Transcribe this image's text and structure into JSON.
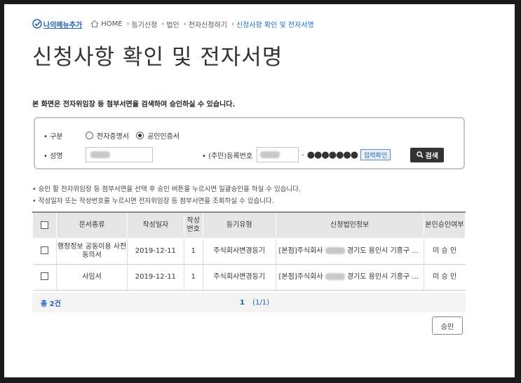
{
  "breadcrumb": {
    "my_menu": "나의메뉴추가",
    "items": [
      "HOME",
      "등기신청",
      "법인",
      "전자신청하기"
    ],
    "current": "신청사항 확인 및 전자서명"
  },
  "page_title": "신청사항 확인 및 전자서명",
  "intro": "본 화면은 전자위임장 등 첨부서면을 검색하여 승인하실 수 있습니다.",
  "search": {
    "type_label": "구분",
    "options": [
      "전자증명서",
      "공인인증서"
    ],
    "selected": "공인인증서",
    "name_label": "성명",
    "reg_label": "(주민)등록번호",
    "reg_masked": "●●●●●●●",
    "confirm_label": "입력확인",
    "search_label": "검색"
  },
  "notes": [
    "승인 할 전자위임장 등 첨부서면을 선택 후 승인 버튼을 누르시면 일괄승인을 하실 수 있습니다.",
    "작성일자 또는 작성번호를 누르시면 전자위임장 등 첨부서면을 조회하실 수 있습니다."
  ],
  "table": {
    "headers": [
      "문서종류",
      "작성일자",
      "작성번호",
      "등기유형",
      "신청법인정보",
      "본인승인여부"
    ],
    "rows": [
      {
        "doc_type": "행정정보 공동이용 사전동의서",
        "date": "2019-12-11",
        "no": "1",
        "reg_type": "주식회사변경등기",
        "corp_prefix": "[본점]주식회사",
        "corp_suffix": "경기도 용인시 기흥구 ...",
        "status": "미 승 인"
      },
      {
        "doc_type": "사임서",
        "date": "2019-12-11",
        "no": "1",
        "reg_type": "주식회사변경등기",
        "corp_prefix": "[본점]주식회사",
        "corp_suffix": "경기도 용인시 기흥구 ...",
        "status": "미 승 인"
      }
    ]
  },
  "footer": {
    "total": "총 2건",
    "current_page": "1",
    "page_info": "(1/1)"
  },
  "approve_label": "승인",
  "colors": {
    "accent": "#1e5fb8",
    "header_bg": "#e6e6e6",
    "search_btn": "#333333"
  }
}
